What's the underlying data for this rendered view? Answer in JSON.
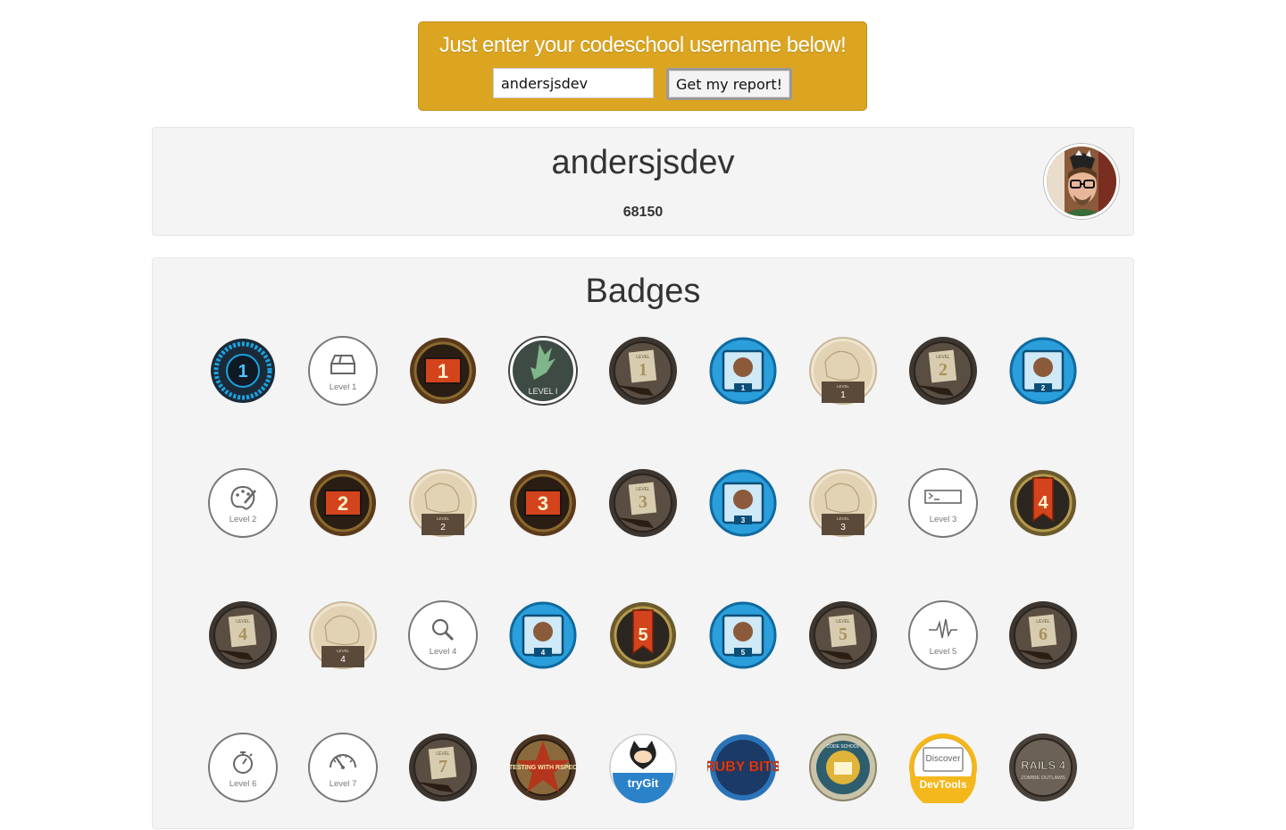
{
  "search": {
    "title": "Just enter your codeschool username below!",
    "input_value": "andersjsdev",
    "button_label": "Get my report!"
  },
  "profile": {
    "username": "andersjsdev",
    "points": "68150"
  },
  "badges": {
    "title": "Badges",
    "items": [
      {
        "style": "tech",
        "text": "1"
      },
      {
        "style": "outline",
        "caption": "Level 1",
        "icon": "box-icon"
      },
      {
        "style": "metal",
        "text": "1"
      },
      {
        "style": "zombie",
        "text": "LEVEL I"
      },
      {
        "style": "western",
        "text": "1"
      },
      {
        "style": "blue",
        "text": "1"
      },
      {
        "style": "parchment",
        "text": "1"
      },
      {
        "style": "western",
        "text": "2"
      },
      {
        "style": "blue",
        "text": "2"
      },
      {
        "style": "outline",
        "caption": "Level 2",
        "icon": "palette-icon"
      },
      {
        "style": "metal",
        "text": "2"
      },
      {
        "style": "parchment",
        "text": "2"
      },
      {
        "style": "metal",
        "text": "3"
      },
      {
        "style": "western",
        "text": "3"
      },
      {
        "style": "blue",
        "text": "3"
      },
      {
        "style": "parchment",
        "text": "3"
      },
      {
        "style": "outline",
        "caption": "Level 3",
        "icon": "terminal-icon"
      },
      {
        "style": "banner",
        "text": "4"
      },
      {
        "style": "western",
        "text": "4"
      },
      {
        "style": "parchment",
        "text": "4"
      },
      {
        "style": "outline",
        "caption": "Level 4",
        "icon": "magnifier-icon"
      },
      {
        "style": "blue",
        "text": "4"
      },
      {
        "style": "banner",
        "text": "5"
      },
      {
        "style": "blue",
        "text": "5"
      },
      {
        "style": "western",
        "text": "5"
      },
      {
        "style": "outline",
        "caption": "Level 5",
        "icon": "pulse-icon"
      },
      {
        "style": "western",
        "text": "6"
      },
      {
        "style": "outline",
        "caption": "Level 6",
        "icon": "stopwatch-icon"
      },
      {
        "style": "outline",
        "caption": "Level 7",
        "icon": "gauge-icon"
      },
      {
        "style": "western",
        "text": "7"
      },
      {
        "style": "rspec",
        "text": "TESTING WITH RSPEC"
      },
      {
        "style": "trygit",
        "text": "tryGit"
      },
      {
        "style": "ruby",
        "text": "RUBY BITS"
      },
      {
        "style": "seal",
        "text": "CODE SCHOOL"
      },
      {
        "style": "devtools",
        "text": "Discover",
        "text2": "DevTools"
      },
      {
        "style": "rails",
        "text": "RAILS 4",
        "text2": "ZOMBIE OUTLAWS"
      }
    ]
  }
}
